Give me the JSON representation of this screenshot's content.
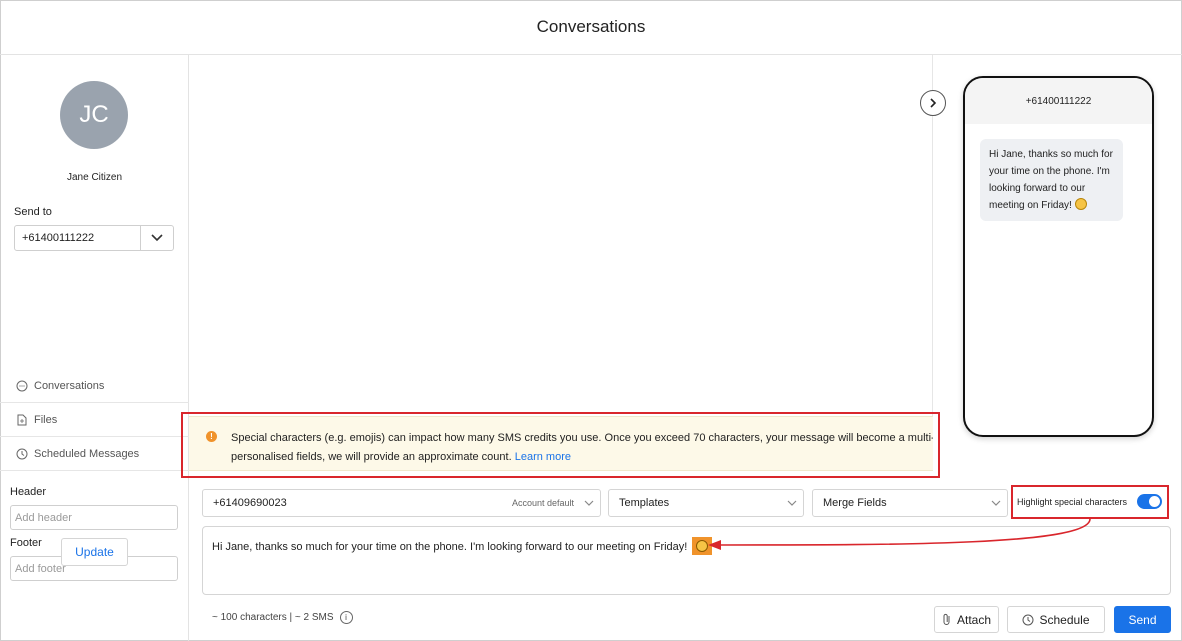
{
  "header": {
    "title": "Conversations"
  },
  "contact": {
    "initials": "JC",
    "name": "Jane Citizen",
    "send_to_label": "Send to",
    "send_to_value": "+61400111222"
  },
  "nav": {
    "conversations": "Conversations",
    "files": "Files",
    "scheduled": "Scheduled Messages"
  },
  "sidebar_form": {
    "header_label": "Header",
    "header_placeholder": "Add header",
    "footer_label": "Footer",
    "footer_placeholder": "Add footer",
    "update_label": "Update"
  },
  "preview": {
    "phone_number": "+61400111222",
    "message": "Hi Jane, thanks so much for your time on the phone. I'm looking forward to our meeting on Friday!"
  },
  "banner": {
    "text_line1": "Special characters (e.g. emojis) can impact how many SMS credits you use. Once you exceed 70 characters, your message will become a multi-part message. If your message contains",
    "text_line2": "personalised fields, we will provide an approximate count.",
    "link": "Learn more"
  },
  "composer": {
    "from_number": "+61409690023",
    "from_sub": "Account default",
    "templates_label": "Templates",
    "merge_label": "Merge Fields",
    "highlight_label": "Highlight special characters",
    "highlight_on": true,
    "message": "Hi Jane, thanks so much for your time on the phone. I'm looking forward to our meeting on Friday!",
    "counter": "~ 100 characters | ~ 2 SMS",
    "attach_label": "Attach",
    "schedule_label": "Schedule",
    "send_label": "Send"
  },
  "colors": {
    "accent": "#1a73e8",
    "warning_bg": "#fdf9e8",
    "highlight_orange": "#f0932b",
    "annotation_red": "#d9262c"
  }
}
